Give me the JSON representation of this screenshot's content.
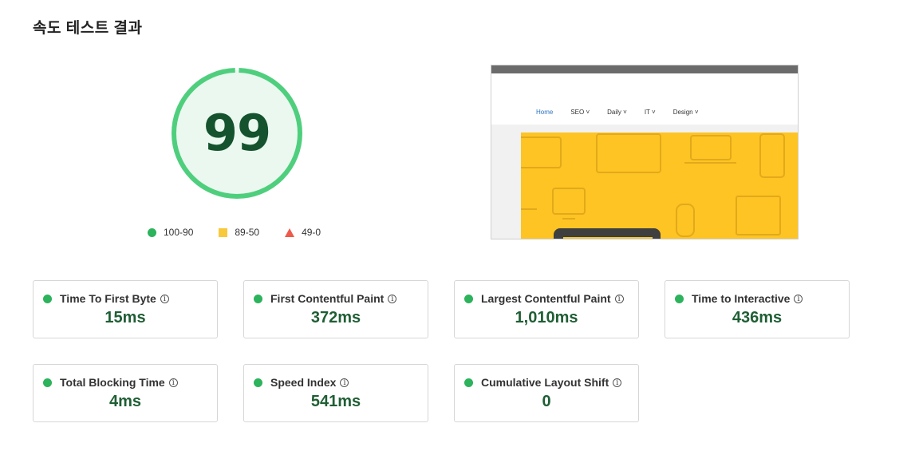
{
  "page": {
    "title": "속도 테스트 결과"
  },
  "score": {
    "value": "99",
    "fraction": 0.99
  },
  "legend": [
    {
      "label": "100-90",
      "color": "#2cb35c",
      "shape": "circle"
    },
    {
      "label": "89-50",
      "color": "#f8c93a",
      "shape": "square"
    },
    {
      "label": "49-0",
      "color": "#ee5a4b",
      "shape": "triangle"
    }
  ],
  "preview": {
    "nav": [
      "Home",
      "SEO ˅",
      "Daily ˅",
      "IT ˅",
      "Design ˅"
    ],
    "active": "Home"
  },
  "metrics": [
    {
      "label": "Time To First Byte",
      "value": "15ms"
    },
    {
      "label": "First Contentful Paint",
      "value": "372ms"
    },
    {
      "label": "Largest Contentful Paint",
      "value": "1,010ms"
    },
    {
      "label": "Time to Interactive",
      "value": "436ms"
    },
    {
      "label": "Total Blocking Time",
      "value": "4ms"
    },
    {
      "label": "Speed Index",
      "value": "541ms"
    },
    {
      "label": "Cumulative Layout Shift",
      "value": "0"
    }
  ],
  "colors": {
    "good": "#2cb35c",
    "gauge_fill": "#eaf8ef",
    "gauge_stroke": "#4fcf7d",
    "value_text": "#1f5e34"
  },
  "icons": {
    "info": "info-circle-icon"
  }
}
